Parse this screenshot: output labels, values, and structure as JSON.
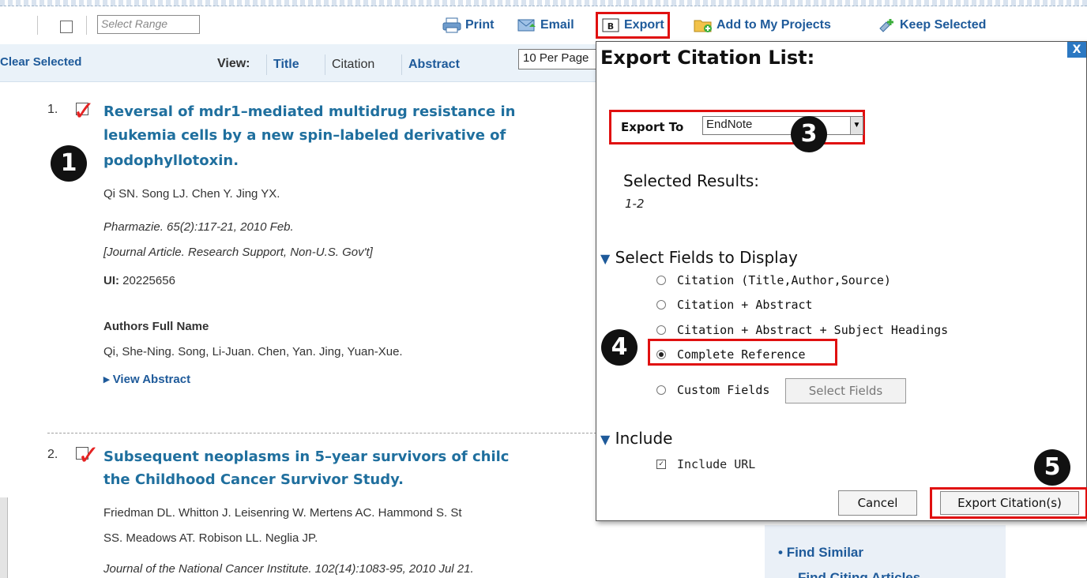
{
  "toolbar": {
    "range_placeholder": "Select Range",
    "print": "Print",
    "email": "Email",
    "export": "Export",
    "add_projects": "Add to My Projects",
    "keep_selected": "Keep Selected"
  },
  "viewbar": {
    "clear_selected": "Clear Selected",
    "view_label": "View:",
    "options": [
      "Title",
      "Citation",
      "Abstract"
    ],
    "per_page": "10 Per Page"
  },
  "results": [
    {
      "num": "1.",
      "title_lines": [
        "Reversal of mdr1–mediated multidrug resistance in",
        "leukemia cells by a new spin–labeled derivative of",
        "podophyllotoxin."
      ],
      "authors": "Qi SN. Song LJ. Chen Y. Jing YX.",
      "source": "Pharmazie. 65(2):117-21, 2010 Feb.",
      "pubtype": "[Journal Article. Research Support, Non-U.S. Gov't]",
      "ui_label": "UI:",
      "ui": "20225656",
      "authors_full_label": "Authors Full Name",
      "authors_full": "Qi, She-Ning. Song, Li-Juan. Chen, Yan. Jing, Yuan-Xue.",
      "view_abstract": "View Abstract"
    },
    {
      "num": "2.",
      "title_lines": [
        "Subsequent neoplasms in 5–year survivors of chilc",
        "the Childhood Cancer Survivor Study."
      ],
      "authors_lines": [
        "Friedman DL. Whitton J. Leisenring W. Mertens AC. Hammond S. St",
        "SS. Meadows AT. Robison LL. Neglia JP."
      ],
      "source": "Journal of the National Cancer Institute. 102(14):1083-95, 2010 Jul 21."
    }
  ],
  "side": {
    "find_similar": "Find Similar",
    "find_citing": "Find Citing Articles"
  },
  "modal": {
    "close": "X",
    "title": "Export Citation List:",
    "export_to_label": "Export To",
    "export_to_value": "EndNote",
    "selected_results_label": "Selected Results:",
    "selected_range": "1-2",
    "fields_title": "Select Fields to Display",
    "fields": [
      "Citation (Title,Author,Source)",
      "Citation + Abstract",
      "Citation + Abstract + Subject Headings",
      "Complete Reference",
      "Custom Fields"
    ],
    "selected_field": "Complete Reference",
    "select_fields_btn": "Select Fields",
    "include_title": "Include",
    "include_url": "Include URL",
    "include_url_checked": true,
    "cancel": "Cancel",
    "export_btn": "Export Citation(s)"
  },
  "annotations": [
    "1",
    "3",
    "4",
    "5"
  ],
  "colors": {
    "link": "#1e5a9a",
    "title": "#1f6f9e",
    "highlight": "#e01010",
    "tick": "#e52222"
  }
}
